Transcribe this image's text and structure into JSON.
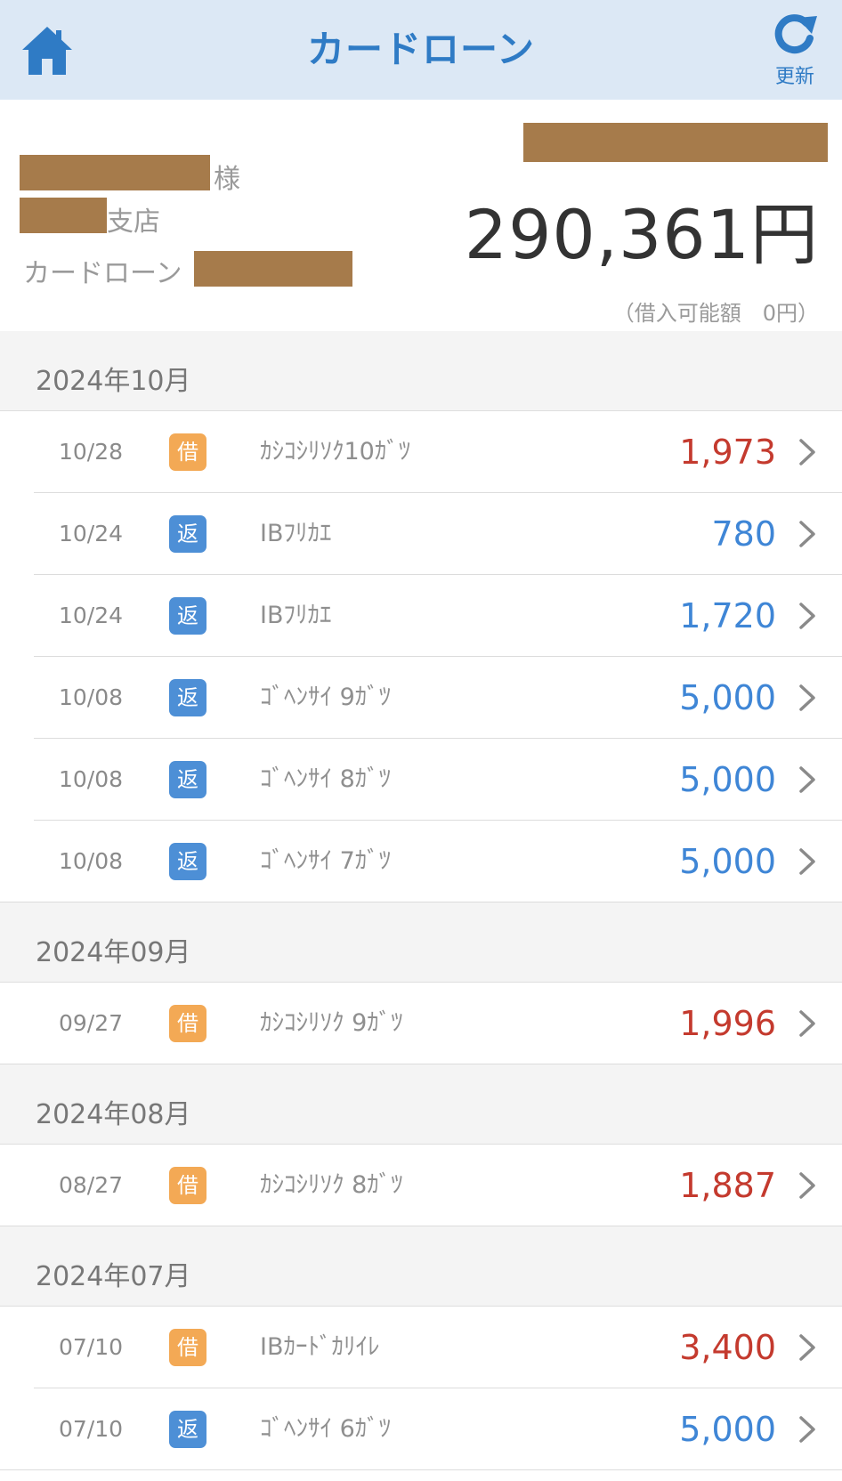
{
  "header": {
    "title": "カードローン",
    "home_icon": "home-icon",
    "refresh_icon": "refresh-icon",
    "refresh_label": "更新",
    "accent": "#2f7bc5",
    "background": "#dce8f5"
  },
  "summary": {
    "name_suffix": "様",
    "branch_suffix": "支店",
    "product_label": "カードローン",
    "balance": "290,361円",
    "limit_text": "（借入可能額　0円）",
    "redaction_color": "#a67b4b"
  },
  "colors": {
    "borrow_badge": "#f3a955",
    "repay_badge": "#4d8fd6",
    "borrow_amount": "#c43a2e",
    "repay_amount": "#3f86d6"
  },
  "months": [
    {
      "label": "2024年10月",
      "transactions": [
        {
          "date": "10/28",
          "type": "borrow",
          "badge": "借",
          "description": "ｶｼｺｼﾘｿｸ10ｶﾞﾂ",
          "amount": "1,973"
        },
        {
          "date": "10/24",
          "type": "repay",
          "badge": "返",
          "description": "IBﾌﾘｶｴ",
          "amount": "780"
        },
        {
          "date": "10/24",
          "type": "repay",
          "badge": "返",
          "description": "IBﾌﾘｶｴ",
          "amount": "1,720"
        },
        {
          "date": "10/08",
          "type": "repay",
          "badge": "返",
          "description": "ｺﾞﾍﾝｻｲ 9ｶﾞﾂ",
          "amount": "5,000"
        },
        {
          "date": "10/08",
          "type": "repay",
          "badge": "返",
          "description": "ｺﾞﾍﾝｻｲ 8ｶﾞﾂ",
          "amount": "5,000"
        },
        {
          "date": "10/08",
          "type": "repay",
          "badge": "返",
          "description": "ｺﾞﾍﾝｻｲ 7ｶﾞﾂ",
          "amount": "5,000"
        }
      ]
    },
    {
      "label": "2024年09月",
      "transactions": [
        {
          "date": "09/27",
          "type": "borrow",
          "badge": "借",
          "description": "ｶｼｺｼﾘｿｸ 9ｶﾞﾂ",
          "amount": "1,996"
        }
      ]
    },
    {
      "label": "2024年08月",
      "transactions": [
        {
          "date": "08/27",
          "type": "borrow",
          "badge": "借",
          "description": "ｶｼｺｼﾘｿｸ 8ｶﾞﾂ",
          "amount": "1,887"
        }
      ]
    },
    {
      "label": "2024年07月",
      "transactions": [
        {
          "date": "07/10",
          "type": "borrow",
          "badge": "借",
          "description": "IBｶｰﾄﾞｶﾘｲﾚ",
          "amount": "3,400"
        },
        {
          "date": "07/10",
          "type": "repay",
          "badge": "返",
          "description": "ｺﾞﾍﾝｻｲ 6ｶﾞﾂ",
          "amount": "5,000"
        }
      ]
    }
  ]
}
